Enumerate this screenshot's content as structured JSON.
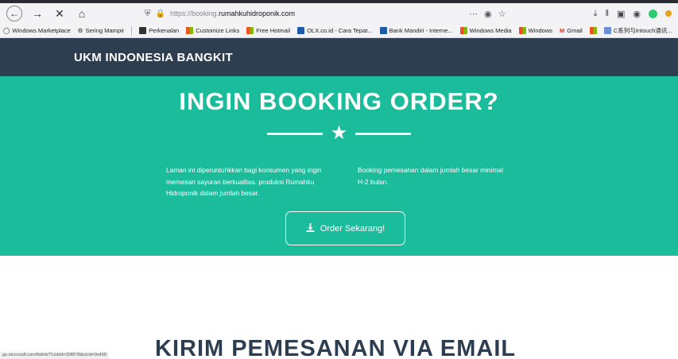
{
  "browser": {
    "url_prefix": "https://booking.",
    "url_domain": "rumahkuhidroponik.com",
    "icons": [
      "back-icon",
      "forward-icon",
      "stop-icon",
      "home-icon",
      "shield-icon",
      "lock-icon",
      "more-icon",
      "pocket-icon",
      "star-bookmark-icon",
      "download-icon",
      "library-icon",
      "sidebar-icon",
      "extension-icons"
    ],
    "status_link": "go.microsoft.com/fwlink/?LinkId=308578&clcid=0x409"
  },
  "bookmarks": [
    {
      "label": "Windows Marketplace",
      "icon": "globe"
    },
    {
      "label": "Sering Mampir",
      "icon": "gear"
    },
    {
      "label": "Perkenalan",
      "icon": "dark"
    },
    {
      "label": "Customize Links",
      "icon": "grid"
    },
    {
      "label": "Free Hotmail",
      "icon": "grid"
    },
    {
      "label": "OLX.co.id - Cara Tepat...",
      "icon": "blue"
    },
    {
      "label": "Bank Mandiri - Interne...",
      "icon": "blue"
    },
    {
      "label": "Windows Media",
      "icon": "grid"
    },
    {
      "label": "Windows",
      "icon": "grid"
    },
    {
      "label": "Gmail",
      "icon": "gmail"
    },
    {
      "label": "",
      "icon": "grid"
    },
    {
      "label": "C系列与Intouch通讯...",
      "icon": "img"
    }
  ],
  "header": {
    "brand": "UKM INDONESIA BANGKIT"
  },
  "booking": {
    "title": "INGIN BOOKING ORDER?",
    "left_text": "Laman ini diperuntuhkkan bagi konsumen yang ingin memesan sayuran berkualitas. produksi Rumahku Hidroponik dalam jumlah besar.",
    "right_text": "Booking pemesanan dalam jumlah besar minimal H-2 bulan.",
    "button_label": "Order Sekarang!"
  },
  "email": {
    "title": "KIRIM PEMESANAN VIA EMAIL"
  },
  "colors": {
    "accent": "#1abc9c",
    "header_bg": "#2c3e50"
  }
}
